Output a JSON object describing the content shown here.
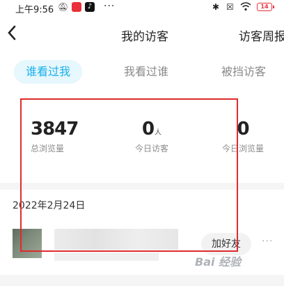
{
  "status_bar": {
    "time": "上午9:56",
    "battery": "14",
    "more": "···"
  },
  "header": {
    "back_glyph": "<",
    "title": "我的访客",
    "weekly": "访客周报"
  },
  "tabs": [
    {
      "label": "谁看过我",
      "active": true
    },
    {
      "label": "我看过谁",
      "active": false
    },
    {
      "label": "被挡访客",
      "active": false
    }
  ],
  "stats": [
    {
      "value": "3847",
      "unit": "",
      "label": "总浏览量"
    },
    {
      "value": "0",
      "unit": "人",
      "label": "今日访客"
    },
    {
      "value": "0",
      "unit": "",
      "label": "今日浏览量"
    }
  ],
  "visitors": {
    "date": "2022年2月24日",
    "items": [
      {
        "add_friend_label": "加好友",
        "more": "···"
      }
    ]
  },
  "watermark": "Bai 经验",
  "colors": {
    "accent": "#1ab0ea",
    "tab_active_bg": "#e6f7fd",
    "highlight": "#e02b2b"
  }
}
